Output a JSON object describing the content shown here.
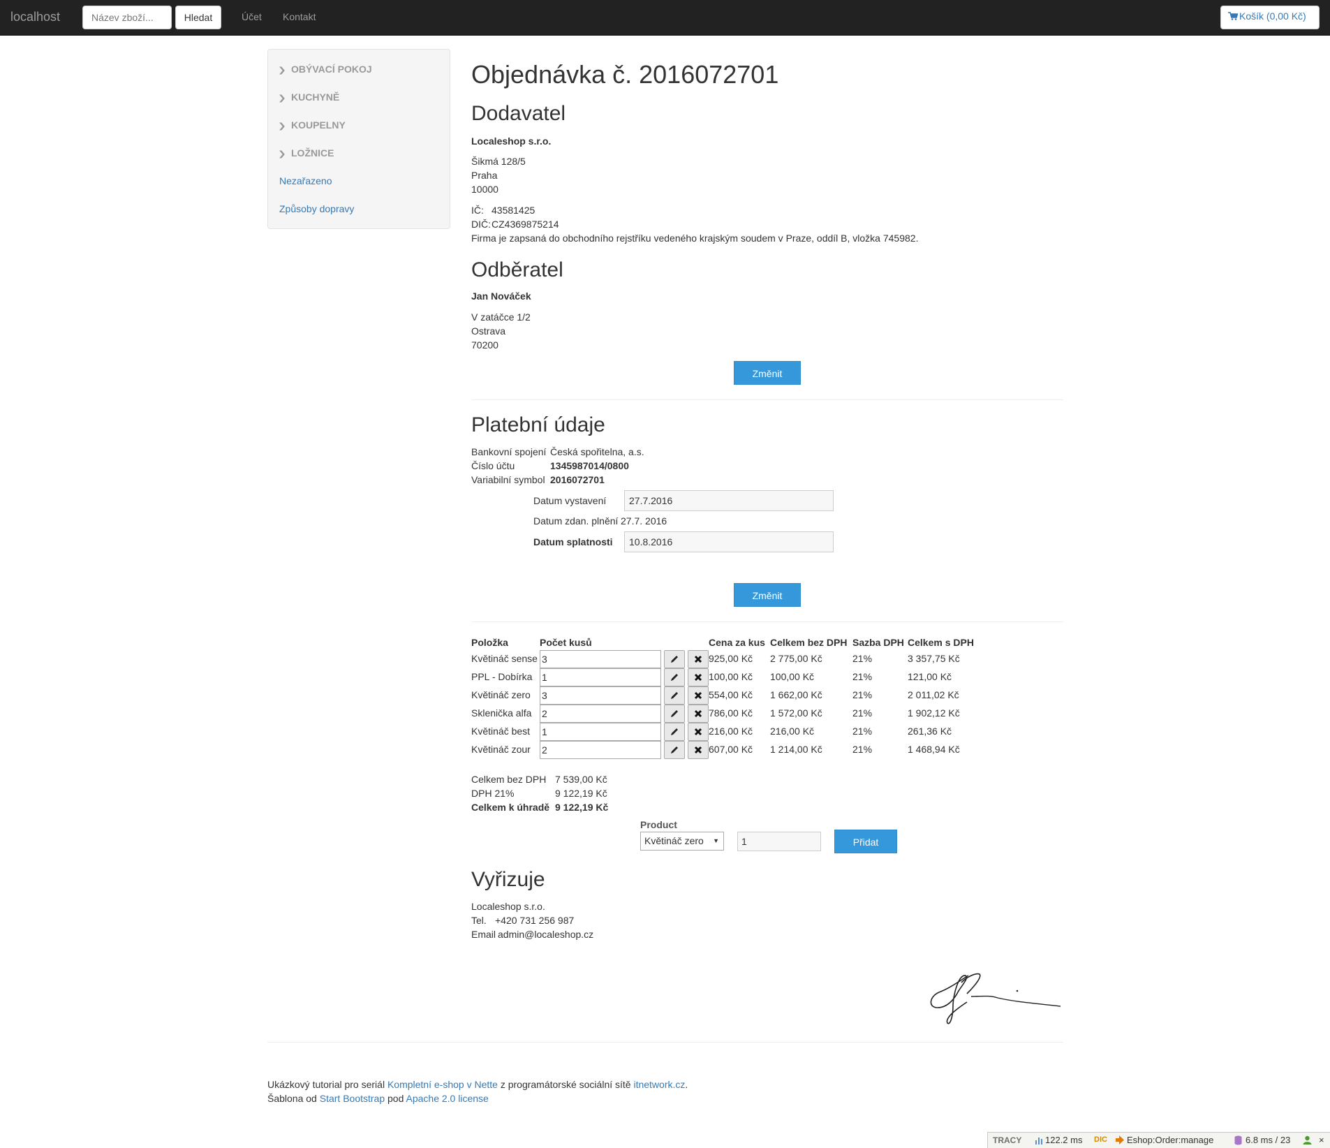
{
  "navbar": {
    "brand": "localhost",
    "search_placeholder": "Název zboží...",
    "search_button": "Hledat",
    "nav_links": [
      "Účet",
      "Kontakt"
    ],
    "cart_label": "Košík (0,00 Kč)"
  },
  "sidebar": {
    "categories": [
      "OBÝVACÍ POKOJ",
      "KUCHYNĚ",
      "KOUPELNY",
      "LOŽNICE"
    ],
    "links": [
      "Nezařazeno",
      "Způsoby dopravy"
    ]
  },
  "order": {
    "title": "Objednávka č. 2016072701",
    "supplier": {
      "heading": "Dodavatel",
      "name": "Localeshop s.r.o.",
      "street": "Šikmá 128/5",
      "city": "Praha",
      "zip": "10000",
      "ic_label": "IČ:",
      "ic_value": "43581425",
      "dic_label": "DIČ:",
      "dic_value": "CZ4369875214",
      "registry": "Firma je zapsaná do obchodního rejstříku vedeného krajským soudem v Praze, oddíl B, vložka 745982."
    },
    "customer": {
      "heading": "Odběratel",
      "name": "Jan Nováček",
      "street": "V zatáčce 1/2",
      "city": "Ostrava",
      "zip": "70200",
      "change_button": "Změnit"
    },
    "payment": {
      "heading": "Platební údaje",
      "bank_label": "Bankovní spojení",
      "bank_value": "Česká spořitelna, a.s.",
      "account_label": "Číslo účtu",
      "account_value": "1345987014/0800",
      "vs_label": "Variabilní symbol",
      "vs_value": "2016072701",
      "issue_label": "Datum vystavení",
      "issue_value": "27.7.2016",
      "taxable_label": "Datum zdan. plnění",
      "taxable_value": "27.7. 2016",
      "due_label": "Datum splatnosti",
      "due_value": "10.8.2016",
      "change_button": "Změnit"
    },
    "items": {
      "headers": [
        "Položka",
        "Počet kusů",
        "Cena za kus",
        "Celkem bez DPH",
        "Sazba DPH",
        "Celkem s DPH"
      ],
      "rows": [
        {
          "name": "Květináč sense",
          "qty": "3",
          "price": "925,00 Kč",
          "total": "2 775,00 Kč",
          "vat": "21%",
          "total_vat": "3 357,75 Kč"
        },
        {
          "name": "PPL - Dobírka",
          "qty": "1",
          "price": "100,00 Kč",
          "total": "100,00 Kč",
          "vat": "21%",
          "total_vat": "121,00 Kč"
        },
        {
          "name": "Květináč zero",
          "qty": "3",
          "price": "554,00 Kč",
          "total": "1 662,00 Kč",
          "vat": "21%",
          "total_vat": "2 011,02 Kč"
        },
        {
          "name": "Sklenička alfa",
          "qty": "2",
          "price": "786,00 Kč",
          "total": "1 572,00 Kč",
          "vat": "21%",
          "total_vat": "1 902,12 Kč"
        },
        {
          "name": "Květináč best",
          "qty": "1",
          "price": "216,00 Kč",
          "total": "216,00 Kč",
          "vat": "21%",
          "total_vat": "261,36 Kč"
        },
        {
          "name": "Květináč zour",
          "qty": "2",
          "price": "607,00 Kč",
          "total": "1 214,00 Kč",
          "vat": "21%",
          "total_vat": "1 468,94 Kč"
        }
      ]
    },
    "totals": {
      "net_label": "Celkem bez DPH",
      "net_value": "7 539,00 Kč",
      "vat_label": "DPH 21%",
      "vat_value": "9 122,19 Kč",
      "grand_label": "Celkem k úhradě",
      "grand_value": "9 122,19 Kč"
    },
    "add_product": {
      "label": "Product",
      "selected": "Květináč zero",
      "quantity": "1",
      "button": "Přidat"
    },
    "handler": {
      "heading": "Vyřizuje",
      "name": "Localeshop s.r.o.",
      "tel_label": "Tel.",
      "tel_value": "+420 731 256 987",
      "email_label": "Email",
      "email_value": "admin@localeshop.cz"
    }
  },
  "footer": {
    "line1_prefix": "Ukázkový tutorial pro seriál ",
    "line1_link1": "Kompletní e-shop v Nette",
    "line1_middle": " z programátorské sociální sítě ",
    "line1_link2": "itnetwork.cz",
    "line1_suffix": ".",
    "line2_prefix": "Šablona od ",
    "line2_link1": "Start Bootstrap",
    "line2_middle": " pod ",
    "line2_link2": "Apache 2.0 license"
  },
  "tracy": {
    "logo": "TRACY",
    "time": "122.2 ms",
    "di": "DIC",
    "presenter": "Eshop:Order:manage",
    "db": "6.8 ms / 23",
    "close": "×"
  },
  "colors": {
    "navbar_bg": "#222222",
    "primary_button": "#3498db",
    "link": "#337ab7"
  }
}
